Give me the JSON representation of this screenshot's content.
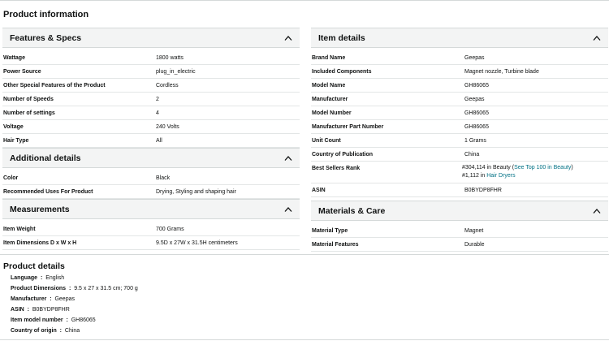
{
  "page_title": "Product information",
  "features": {
    "title": "Features & Specs",
    "rows": [
      {
        "k": "Wattage",
        "v": "1800 watts"
      },
      {
        "k": "Power Source",
        "v": "plug_in_electric"
      },
      {
        "k": "Other Special Features of the Product",
        "v": "Cordless"
      },
      {
        "k": "Number of Speeds",
        "v": "2"
      },
      {
        "k": "Number of settings",
        "v": "4"
      },
      {
        "k": "Voltage",
        "v": "240 Volts"
      },
      {
        "k": "Hair Type",
        "v": "All"
      }
    ]
  },
  "additional": {
    "title": "Additional details",
    "rows": [
      {
        "k": "Color",
        "v": "Black"
      },
      {
        "k": "Recommended Uses For Product",
        "v": "Drying, Styling and shaping hair"
      }
    ]
  },
  "measurements": {
    "title": "Measurements",
    "rows": [
      {
        "k": "Item Weight",
        "v": "700 Grams"
      },
      {
        "k": "Item Dimensions D x W x H",
        "v": "9.5D x 27W x 31.5H centimeters"
      }
    ]
  },
  "item_details": {
    "title": "Item details",
    "rows": [
      {
        "k": "Brand Name",
        "v": "Geepas"
      },
      {
        "k": "Included Components",
        "v": "Magnet nozzle, Turbine blade"
      },
      {
        "k": "Model Name",
        "v": "GH86065"
      },
      {
        "k": "Manufacturer",
        "v": "Geepas"
      },
      {
        "k": "Model Number",
        "v": "GH86065"
      },
      {
        "k": "Manufacturer Part Number",
        "v": "GH86065"
      },
      {
        "k": "Unit Count",
        "v": "1 Grams"
      },
      {
        "k": "Country of Publication",
        "v": "China"
      }
    ],
    "best_sellers": {
      "label": "Best Sellers Rank",
      "line1_prefix": "#304,114 in Beauty (",
      "line1_link": "See Top 100 in Beauty",
      "line1_suffix": ")",
      "line2_prefix": "#1,112 in ",
      "line2_link": "Hair Dryers"
    },
    "asin": {
      "k": "ASIN",
      "v": "B0BYDP8FHR"
    }
  },
  "materials": {
    "title": "Materials & Care",
    "rows": [
      {
        "k": "Material Type",
        "v": "Magnet"
      },
      {
        "k": "Material Features",
        "v": "Durable"
      }
    ]
  },
  "product_details": {
    "title": "Product details",
    "items": [
      {
        "k": "Language",
        "v": "English"
      },
      {
        "k": "Product Dimensions",
        "v": "9.5 x 27 x 31.5 cm; 700 g"
      },
      {
        "k": "Manufacturer",
        "v": "Geepas"
      },
      {
        "k": "ASIN",
        "v": "B0BYDP8FHR"
      },
      {
        "k": "Item model number",
        "v": "GH86065"
      },
      {
        "k": "Country of origin",
        "v": "China"
      }
    ]
  },
  "icons": {
    "collapse": "chevron-up-icon"
  },
  "colors": {
    "link": "#007185",
    "section_bg": "#f3f4f4",
    "border": "#d5d9d9"
  }
}
